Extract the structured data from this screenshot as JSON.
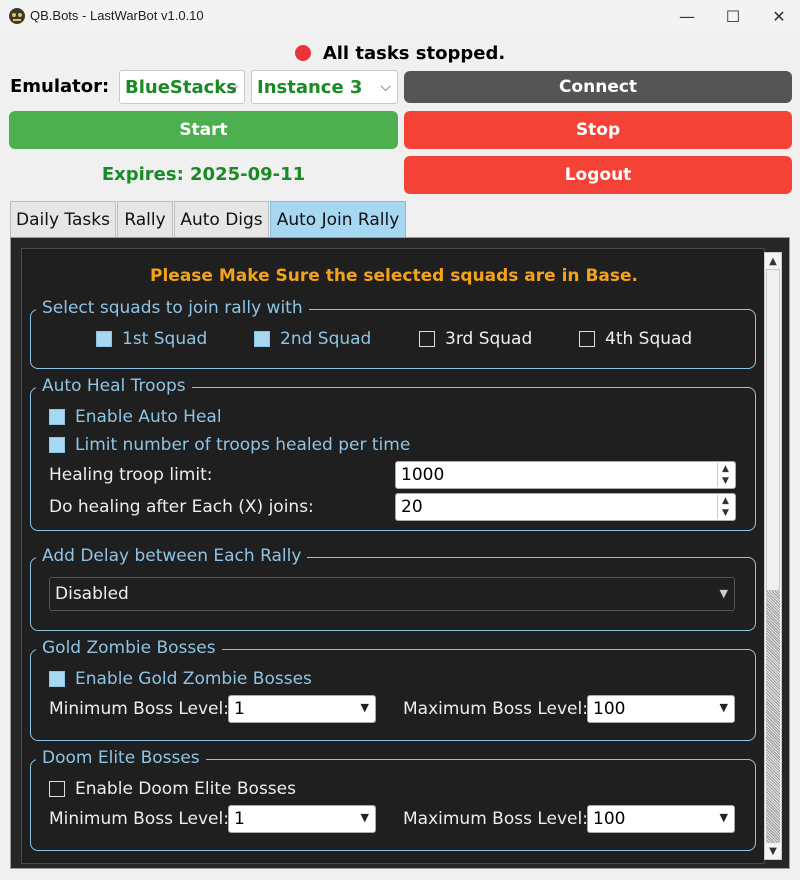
{
  "window": {
    "title": "QB.Bots - LastWarBot v1.0.10",
    "minimize": "—",
    "maximize": "☐",
    "close": "✕"
  },
  "status": {
    "text": "All tasks stopped.",
    "color": "#e8343a"
  },
  "emulator": {
    "label": "Emulator:",
    "emulator_value": "BlueStacks",
    "instance_value": "Instance 3"
  },
  "buttons": {
    "connect": "Connect",
    "start": "Start",
    "stop": "Stop",
    "logout": "Logout"
  },
  "expires": "Expires: 2025-09-11",
  "tabs": [
    "Daily Tasks",
    "Rally",
    "Auto Digs",
    "Auto Join Rally"
  ],
  "active_tab": "Auto Join Rally",
  "content": {
    "warning": "Please Make Sure the selected squads are in Base.",
    "squads": {
      "title": "Select squads to join rally with",
      "items": [
        {
          "label": "1st Squad",
          "checked": true
        },
        {
          "label": "2nd Squad",
          "checked": true
        },
        {
          "label": "3rd Squad",
          "checked": false
        },
        {
          "label": "4th Squad",
          "checked": false
        }
      ]
    },
    "heal": {
      "title": "Auto Heal Troops",
      "enable_label": "Enable Auto Heal",
      "limit_label": "Limit number of troops healed per time",
      "troop_limit_label": "Healing troop limit:",
      "troop_limit_value": "1000",
      "after_joins_label": "Do healing after Each (X) joins:",
      "after_joins_value": "20"
    },
    "delay": {
      "title": "Add Delay between Each Rally",
      "value": "Disabled"
    },
    "gold": {
      "title": "Gold Zombie Bosses",
      "enable_label": "Enable Gold Zombie Bosses",
      "min_label": "Minimum Boss Level:",
      "min_value": "1",
      "max_label": "Maximum Boss Level:",
      "max_value": "100"
    },
    "doom": {
      "title": "Doom Elite Bosses",
      "enable_label": "Enable Doom Elite Bosses",
      "min_label": "Minimum Boss Level:",
      "min_value": "1",
      "max_label": "Maximum Boss Level:",
      "max_value": "100"
    }
  }
}
